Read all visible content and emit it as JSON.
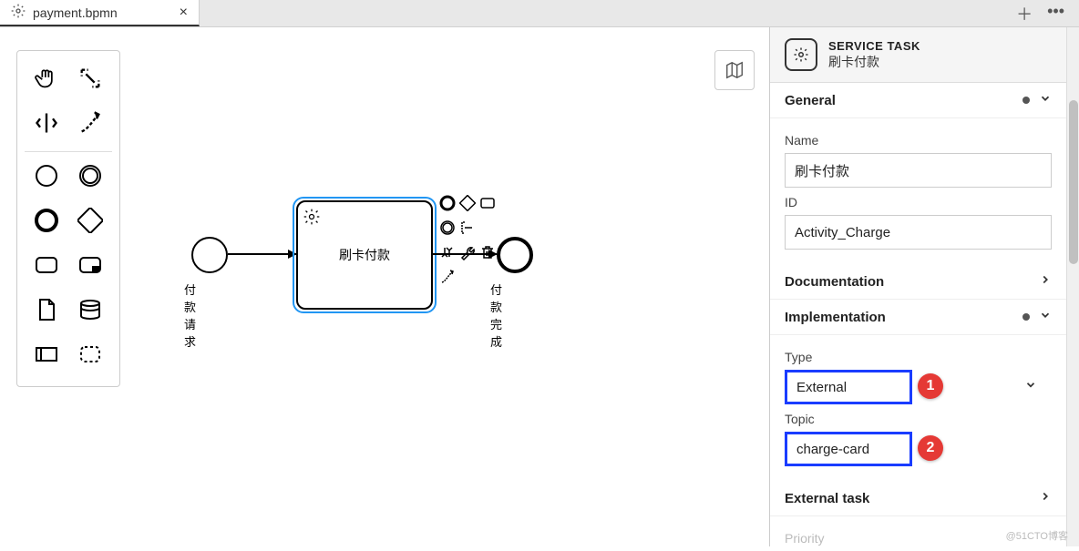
{
  "tab": {
    "filename": "payment.bpmn"
  },
  "diagram": {
    "start_label": "付款请求",
    "task_name": "刷卡付款",
    "end_label": "付款完成"
  },
  "props": {
    "header": {
      "type": "SERVICE TASK",
      "name": "刷卡付款"
    },
    "general": {
      "title": "General",
      "name_label": "Name",
      "name_value": "刷卡付款",
      "id_label": "ID",
      "id_value": "Activity_Charge"
    },
    "documentation": {
      "title": "Documentation"
    },
    "implementation": {
      "title": "Implementation",
      "type_label": "Type",
      "type_value": "External",
      "topic_label": "Topic",
      "topic_value": "charge-card"
    },
    "external_task": {
      "title": "External task",
      "priority_label": "Priority"
    }
  },
  "callouts": {
    "c1": "1",
    "c2": "2"
  },
  "watermark": "@51CTO博客"
}
